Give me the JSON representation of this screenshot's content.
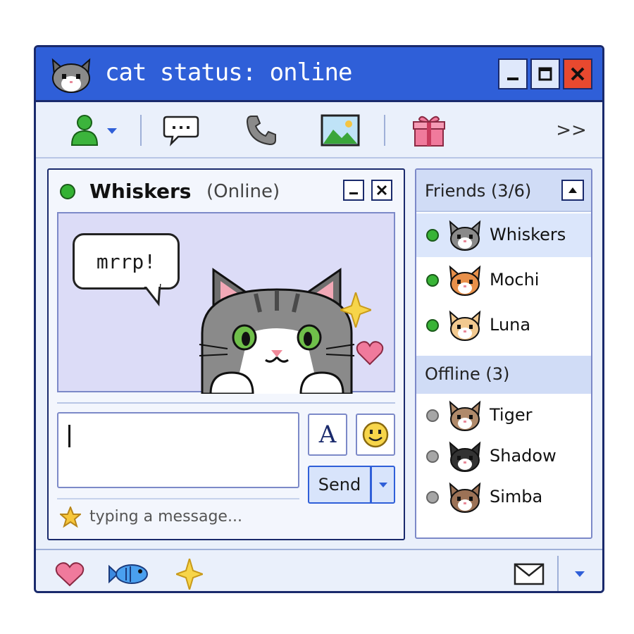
{
  "window": {
    "title": "cat status: online",
    "controls": [
      "minimize",
      "maximize",
      "close"
    ]
  },
  "toolbar": {
    "icons": [
      "user-status-icon",
      "chat-icon",
      "phone-icon",
      "picture-icon",
      "gift-icon"
    ],
    "more_label": ">>"
  },
  "chat": {
    "contact_name": "Whiskers",
    "contact_status": "(Online)",
    "speech": "mrrp!",
    "input_value": "",
    "font_label": "A",
    "send_label": "Send",
    "typing_status": "typing a message..."
  },
  "friends": {
    "header": "Friends (3/6)",
    "online": [
      {
        "name": "Whiskers",
        "fur": "#8a8a8a",
        "selected": true
      },
      {
        "name": "Mochi",
        "fur": "#e8904a",
        "selected": false
      },
      {
        "name": "Luna",
        "fur": "#f2c98f",
        "selected": false
      }
    ],
    "offline_header": "Offline (3)",
    "offline": [
      {
        "name": "Tiger",
        "fur": "#b08a6a"
      },
      {
        "name": "Shadow",
        "fur": "#333333"
      },
      {
        "name": "Simba",
        "fur": "#9c7256"
      }
    ]
  },
  "bottombar": {
    "icons": [
      "heart-icon",
      "fish-icon",
      "sparkle-icon",
      "mail-icon",
      "chevron-down-icon"
    ]
  },
  "colors": {
    "titlebar": "#2f5fd8",
    "online": "#38b436",
    "offline": "#a6a6a6",
    "close": "#e8492f"
  }
}
